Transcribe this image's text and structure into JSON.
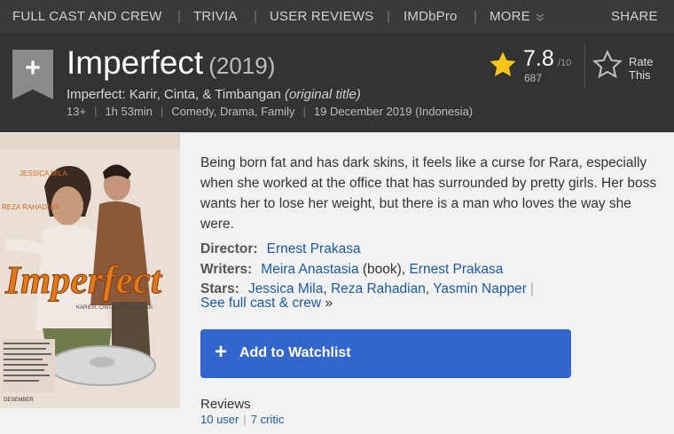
{
  "nav": {
    "items": [
      "FULL CAST AND CREW",
      "TRIVIA",
      "USER REVIEWS",
      "IMDbPro",
      "MORE"
    ],
    "share": "SHARE"
  },
  "title": {
    "name": "Imperfect",
    "year": "(2019)",
    "original_prefix": "Imperfect: Karir, Cinta, & Timbangan",
    "original_suffix": "(original title)",
    "certificate": "13+",
    "runtime": "1h 53min",
    "genres": "Comedy, Drama, Family",
    "release": "19 December 2019 (Indonesia)"
  },
  "rating": {
    "score": "7.8",
    "out_of": "/10",
    "votes": "687",
    "rate_label_1": "Rate",
    "rate_label_2": "This"
  },
  "plot": "Being born fat and has dark skins, it feels like a curse for Rara, especially when she worked at the office that has surrounded by pretty girls. Her boss wants her to lose her weight, but there is a man who loves the way she were.",
  "credits": {
    "director_label": "Director:",
    "director": "Ernest Prakasa",
    "writers_label": "Writers:",
    "writer_1": "Meira Anastasia",
    "writer_1_note": "(book),",
    "writer_2": "Ernest Prakasa",
    "stars_label": "Stars:",
    "star_1": "Jessica Mila",
    "star_2": "Reza Rahadian",
    "star_3": "Yasmin Napper",
    "see_all": "See full cast & crew",
    "see_all_arrow": "»"
  },
  "watchlist": {
    "plus": "+",
    "label": "Add to Watchlist"
  },
  "reviews": {
    "title": "Reviews",
    "user": "10 user",
    "critic": "7 critic"
  },
  "poster": {
    "title_text": "Imperfect",
    "cast_1": "JESSICA MILA",
    "cast_2": "REZA RAHADIAN",
    "subtitle": "KARIER, CINTA & TIMBANGAN",
    "release_text": "DESEMBER"
  },
  "colors": {
    "accent": "#3366cc",
    "link": "#1a5aa8",
    "star": "#f5c518",
    "header_bg": "#333333"
  }
}
